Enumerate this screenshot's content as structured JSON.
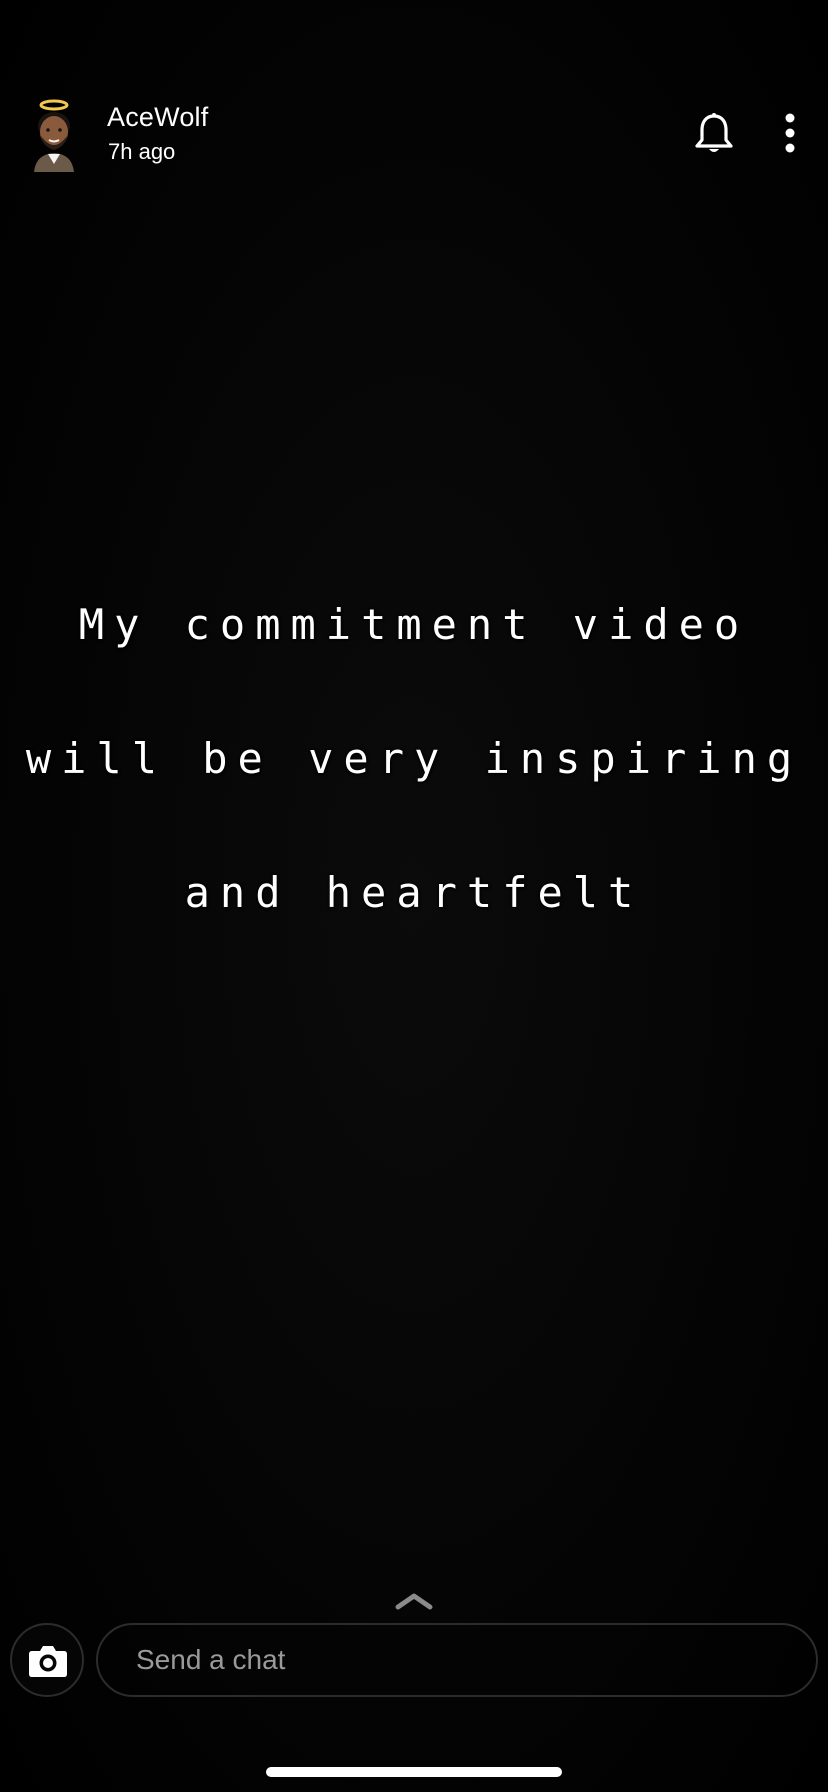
{
  "story": {
    "user_name": "AceWolf",
    "time_ago": "7h ago",
    "caption": {
      "line1": "My commitment video",
      "line2": "will be very inspiring",
      "line3": "and heartfelt"
    }
  },
  "chat": {
    "placeholder": "Send a chat"
  },
  "icons": {
    "avatar": "bitmoji-avatar-with-halo",
    "notifications": "bell-icon",
    "more": "more-vertical-icon",
    "swipe_up": "chevron-up-icon",
    "camera": "camera-icon"
  },
  "colors": {
    "background": "#000000",
    "text": "#ffffff",
    "placeholder": "#9a9a9a",
    "border": "#2c2c2c"
  }
}
